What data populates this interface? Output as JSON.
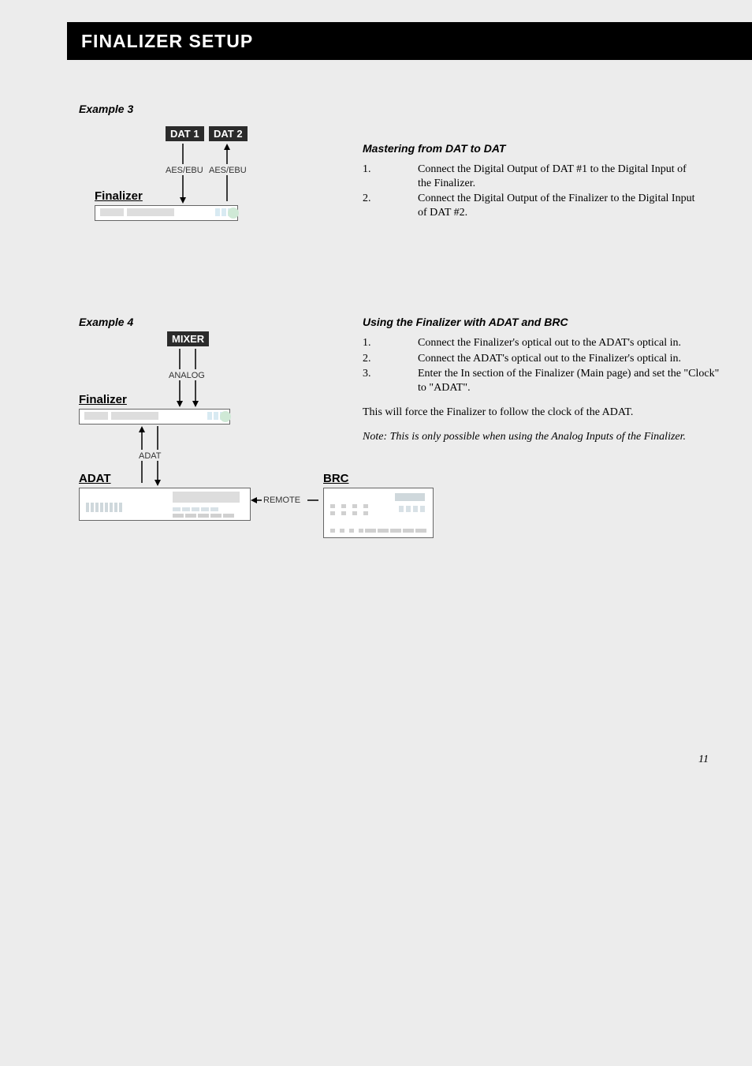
{
  "header": "FINALIZER SETUP",
  "page_number": "11",
  "example3": {
    "label": "Example 3",
    "dat1": "DAT 1",
    "dat2": "DAT 2",
    "aes": "AES/EBU",
    "finalizer": "Finalizer",
    "title": "Mastering from DAT to DAT",
    "steps": [
      {
        "n": "1.",
        "t": "Connect the Digital Output of DAT #1 to the Digital Input of the Finalizer."
      },
      {
        "n": "2.",
        "t": "Connect the Digital Output of the Finalizer to the Digital Input of DAT #2."
      }
    ]
  },
  "example4": {
    "label": "Example 4",
    "mixer": "MIXER",
    "analog": "ANALOG",
    "finalizer": "Finalizer",
    "adat_small": "ADAT",
    "adat": "ADAT",
    "brc": "BRC",
    "remote": "REMOTE",
    "title": "Using the Finalizer with ADAT and BRC",
    "steps": [
      {
        "n": "1.",
        "t": "Connect the Finalizer's optical out to the ADAT's optical in."
      },
      {
        "n": "2.",
        "t": "Connect the ADAT's optical out to the Finalizer's optical in."
      },
      {
        "n": "3.",
        "t": "Enter the In section of the Finalizer (Main page) and set the \"Clock\" to \"ADAT\"."
      }
    ],
    "para": "This will force the Finalizer to follow the clock of the ADAT.",
    "note": "Note: This is only possible when using the Analog Inputs of the Finalizer."
  }
}
